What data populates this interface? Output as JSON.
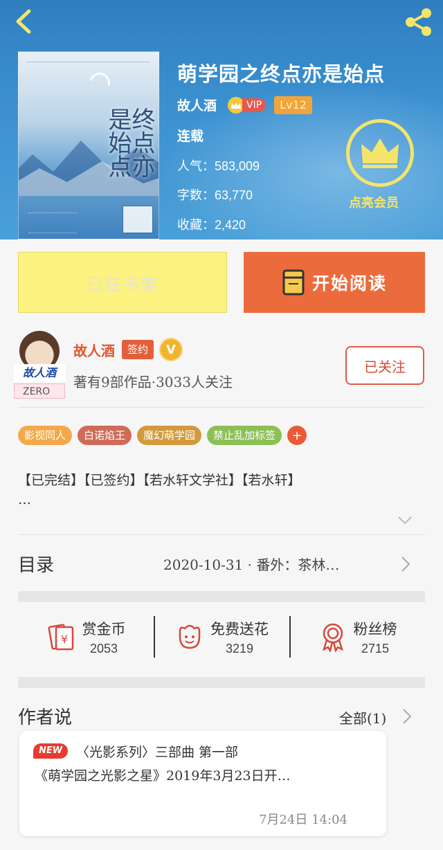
{
  "book": {
    "title": "萌学园之终点亦是始点",
    "author": "故人酒",
    "vip_label": "VIP",
    "level": "Lv12",
    "status": "连载",
    "stats": [
      {
        "label": "人气：",
        "value": "583,009"
      },
      {
        "label": "字数：",
        "value": "63,770"
      },
      {
        "label": "收藏：",
        "value": "2,420"
      }
    ],
    "cover_title": "终点亦是始点",
    "member_label": "点亮会员"
  },
  "actions": {
    "shelf_label": "已在书架",
    "read_label": "开始阅读"
  },
  "author": {
    "name": "故人酒",
    "sign_label": "签约",
    "v_label": "V",
    "subtitle": "著有9部作品·3033人关注",
    "follow_label": "已关注",
    "avatar_text": "ZERO"
  },
  "tags": [
    {
      "label": "影视同人",
      "color": "#f3a94a"
    },
    {
      "label": "白诺焰王",
      "color": "#cf6b58"
    },
    {
      "label": "魔幻萌学园",
      "color": "#d29a3c"
    },
    {
      "label": "禁止乱加标签",
      "color": "#8cbf55"
    }
  ],
  "tag_more": "+",
  "description": {
    "line1": "【已完结】【已签约】【若水轩文学社】【若水轩】",
    "line2": "…"
  },
  "toc": {
    "label": "目录",
    "latest": "2020-10-31 · 番外：茶林…"
  },
  "support": [
    {
      "title": "赏金币",
      "count": "2053",
      "icon": "coin-bag-icon"
    },
    {
      "title": "免费送花",
      "count": "3219",
      "icon": "flower-icon"
    },
    {
      "title": "粉丝榜",
      "count": "2715",
      "icon": "medal-icon"
    }
  ],
  "author_say": {
    "title": "作者说",
    "all_label": "全部(1)",
    "badge": "NEW",
    "line1": "〈光影系列〉三部曲 第一部",
    "line2": "《萌学园之光影之星》2019年3月23日开…",
    "time": "7月24日  14:04"
  },
  "colors": {
    "header": "#3a8fcf",
    "accent": "#ec6b3c",
    "shelf": "#fbf280",
    "member": "#f5e46a"
  }
}
